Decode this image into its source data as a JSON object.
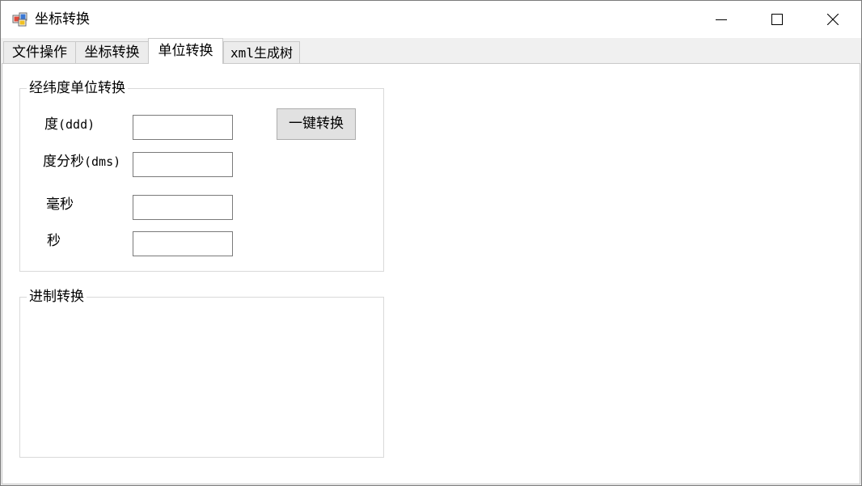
{
  "window": {
    "title": "坐标转换"
  },
  "tabs": [
    {
      "label": "文件操作"
    },
    {
      "label": "坐标转换"
    },
    {
      "label": "单位转换"
    },
    {
      "label": "xml生成树"
    }
  ],
  "unit_group": {
    "title": "经纬度单位转换",
    "degree_label": "度",
    "degree_unit": "(ddd)",
    "dms_label": "度分秒",
    "dms_unit": "(dms)",
    "millisecond_label": "毫秒",
    "second_label": "秒",
    "degree_value": "",
    "dms_value": "",
    "millisecond_value": "",
    "second_value": "",
    "convert_button": "一键转换"
  },
  "radix_group": {
    "title": "进制转换"
  },
  "colors": {
    "button_bg": "#e1e1e1",
    "border": "#7a7a7a"
  }
}
